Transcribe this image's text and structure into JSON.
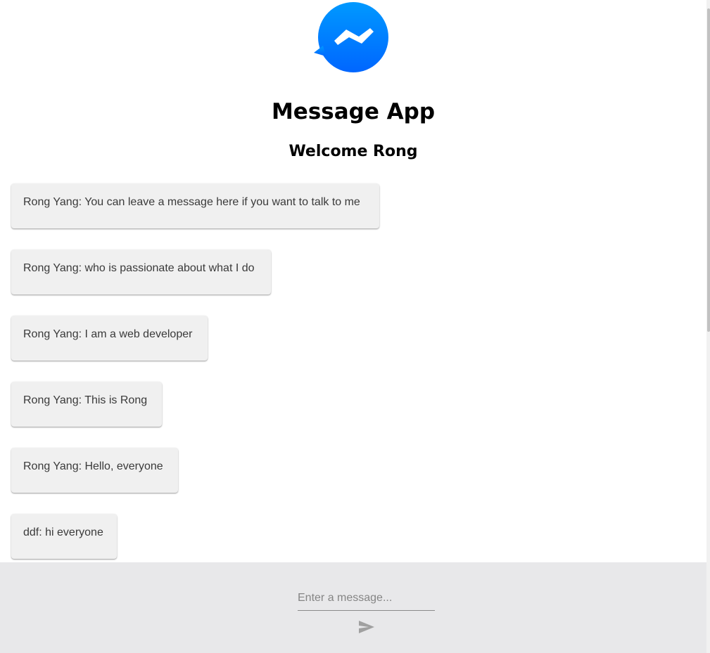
{
  "header": {
    "logo_icon": "messenger-logo-icon",
    "title": "Message App",
    "welcome": "Welcome Rong"
  },
  "messages": [
    {
      "text": "Rong Yang: You can leave a message here if you want to talk to me"
    },
    {
      "text": "Rong Yang: who is passionate about what I do"
    },
    {
      "text": "Rong Yang: I am a web developer"
    },
    {
      "text": "Rong Yang: This is Rong"
    },
    {
      "text": "Rong Yang: Hello, everyone"
    },
    {
      "text": "ddf: hi everyone"
    }
  ],
  "composer": {
    "placeholder": "Enter a message...",
    "value": "",
    "send_icon": "send-icon"
  },
  "colors": {
    "logo_gradient_top": "#0095ff",
    "logo_gradient_bottom": "#0064ff",
    "message_background": "#f0f0f0",
    "footer_background": "#e8e8ea",
    "send_icon": "#a0a0a0"
  }
}
